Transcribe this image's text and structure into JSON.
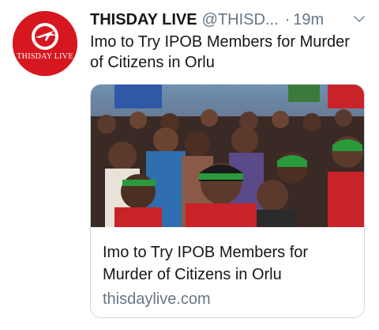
{
  "tweet": {
    "author_name": "THISDAY LIVE",
    "handle": "@THISD...",
    "separator": "·",
    "time": "19m",
    "text": "Imo to Try IPOB Members for Murder of Citizens in Orlu"
  },
  "avatar": {
    "logo_text": "THISDAY LIVE",
    "background_color": "#d7171f"
  },
  "card": {
    "title": "Imo to Try IPOB Members for Murder of Citizens in Orlu",
    "domain": "thisdaylive.com"
  },
  "colors": {
    "primary_text": "#14171a",
    "secondary_text": "#657786",
    "card_border": "#ccd6dd"
  },
  "icons": {
    "menu": "chevron-down-icon"
  }
}
